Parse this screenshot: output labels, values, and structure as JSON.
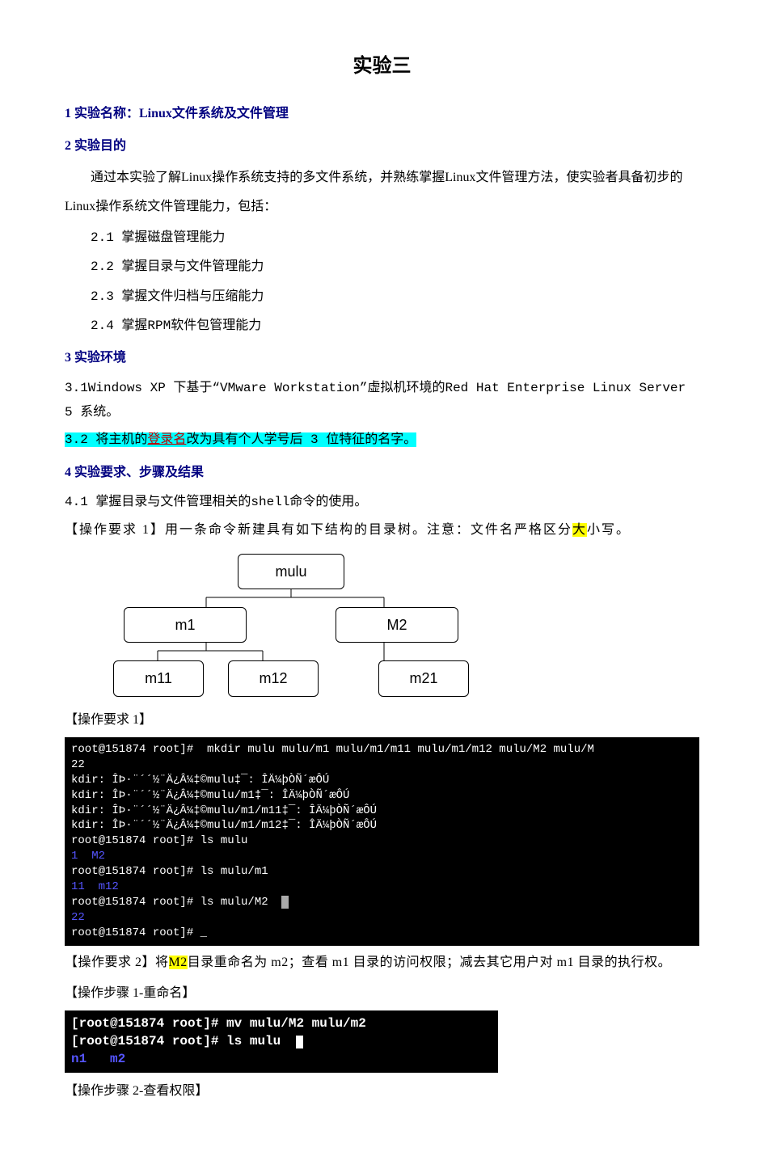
{
  "title": "实验三",
  "s1": {
    "head": "1 实验名称：Linux文件系统及文件管理"
  },
  "s2": {
    "head": "2 实验目的",
    "body": "通过本实验了解Linux操作系统支持的多文件系统，并熟练掌握Linux文件管理方法，使实验者具备初步的Linux操作系统文件管理能力，包括：",
    "i1": "2.1 掌握磁盘管理能力",
    "i2": "2.2 掌握目录与文件管理能力",
    "i3": "2.3 掌握文件归档与压缩能力",
    "i4": "2.4 掌握RPM软件包管理能力"
  },
  "s3": {
    "head": "3 实验环境",
    "l1a": "3.1Windows XP 下基于“VMware Workstation”虚拟机环境的",
    "l1b": "Red Hat Enterprise Linux Server 5 ",
    "l1c": "系统。",
    "l2a": "3.2 将主机的",
    "l2b": "登录名",
    "l2c": "改为具有个人学号后 3 位特征的名字。"
  },
  "s4": {
    "head": "4 实验要求、步骤及结果",
    "p1": "4.1 掌握目录与文件管理相关的shell命令的使用。",
    "req1a": "【操作要求 1】用一条命令新建具有如下结构的目录树。注意：文件名严格区分",
    "req1_da": "大",
    "req1b": "小写。"
  },
  "tree": {
    "root": "mulu",
    "n1": "m1",
    "n2": "M2",
    "n11": "m11",
    "n12": "m12",
    "n21": "m21"
  },
  "labels": {
    "op1": "【操作要求 1】",
    "op2a": "【操作要求 2】将",
    "op2_m2": "M2",
    "op2b": "目录重命名为 m2；查看 m1 目录的访问权限；减去其它用户对 m1 目录的执行权。",
    "step1": "【操作步骤 1-重命名】",
    "step2": "【操作步骤 2-查看权限】"
  },
  "term1": {
    "l1": "root@151874 root]#  mkdir mulu mulu/m1 mulu/m1/m11 mulu/m1/m12 mulu/M2 mulu/M",
    "l1b": "22",
    "l2": "kdir: ÎÞ·¨´´½¨Ä¿Â¼‡©mulu‡¯: ÎÄ¼þÒÑ´æÔÚ",
    "l3": "kdir: ÎÞ·¨´´½¨Ä¿Â¼‡©mulu/m1‡¯: ÎÄ¼þÒÑ´æÔÚ",
    "l4": "kdir: ÎÞ·¨´´½¨Ä¿Â¼‡©mulu/m1/m11‡¯: ÎÄ¼þÒÑ´æÔÚ",
    "l5": "kdir: ÎÞ·¨´´½¨Ä¿Â¼‡©mulu/m1/m12‡¯: ÎÄ¼þÒÑ´æÔÚ",
    "l6": "root@151874 root]# ls mulu",
    "l7a": "1",
    "l7b": "  M2",
    "l8": "root@151874 root]# ls mulu/m1",
    "l9a": "11",
    "l9b": "  m12",
    "l10": "root@151874 root]# ls mulu/M2",
    "l11": "22",
    "l12": "root@151874 root]# _"
  },
  "term2": {
    "l1": "[root@151874 root]# mv mulu/M2 mulu/m2",
    "l2": "[root@151874 root]# ls mulu  ",
    "l3a": "n1",
    "l3b": "   m2"
  }
}
